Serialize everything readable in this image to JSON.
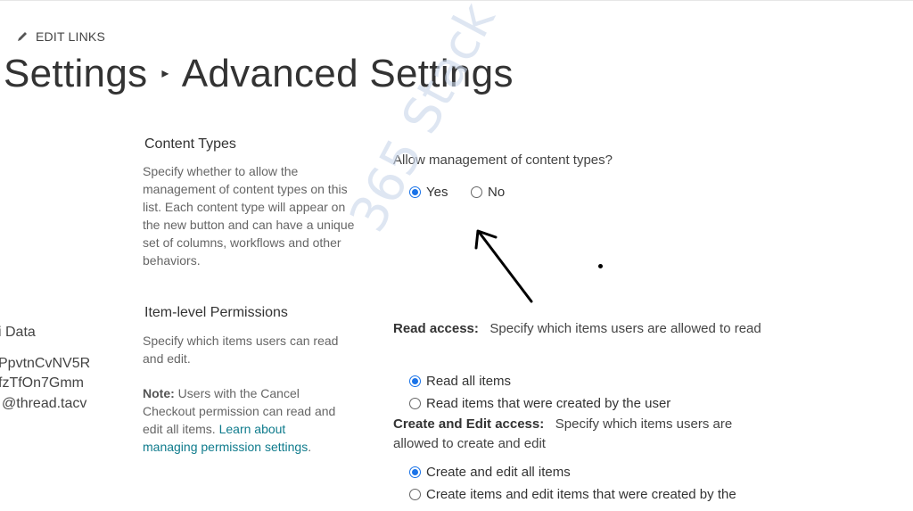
{
  "header": {
    "edit_links": "EDIT LINKS",
    "breadcrumb_parent": "Settings",
    "breadcrumb_current": "Advanced Settings"
  },
  "left_nav": [
    "i Data",
    "PpvtnCvNV5R",
    "fzTfOn7Gmm",
    "@thread.tacv"
  ],
  "content_types": {
    "heading": "Content Types",
    "description": "Specify whether to allow the management of content types on this list. Each content type will appear on the new button and can have a unique set of columns, workflows and other behaviors.",
    "question": "Allow management of content types?",
    "options": [
      {
        "label": "Yes",
        "checked": true
      },
      {
        "label": "No",
        "checked": false
      }
    ]
  },
  "item_permissions": {
    "heading": "Item-level Permissions",
    "description": "Specify which items users can read and edit.",
    "note_label": "Note:",
    "note_text": "Users with the Cancel Checkout permission can read and edit all items.",
    "learn_more": "Learn about managing permission settings",
    "read_access_label": "Read access:",
    "read_access_text": "Specify which items users are allowed to read",
    "read_options": [
      {
        "label": "Read all items",
        "checked": true
      },
      {
        "label": "Read items that were created by the user",
        "checked": false
      }
    ],
    "edit_access_label": "Create and Edit access:",
    "edit_access_text": "Specify which items users are allowed to create and edit",
    "edit_options": [
      {
        "label": "Create and edit all items",
        "checked": true
      },
      {
        "label": "Create items and edit items that were created by the",
        "checked": false
      }
    ]
  },
  "watermark": "365 Stack",
  "colors": {
    "accent": "#1a73e8",
    "link": "#0f7b8c",
    "text": "#333333",
    "muted": "#666666"
  }
}
